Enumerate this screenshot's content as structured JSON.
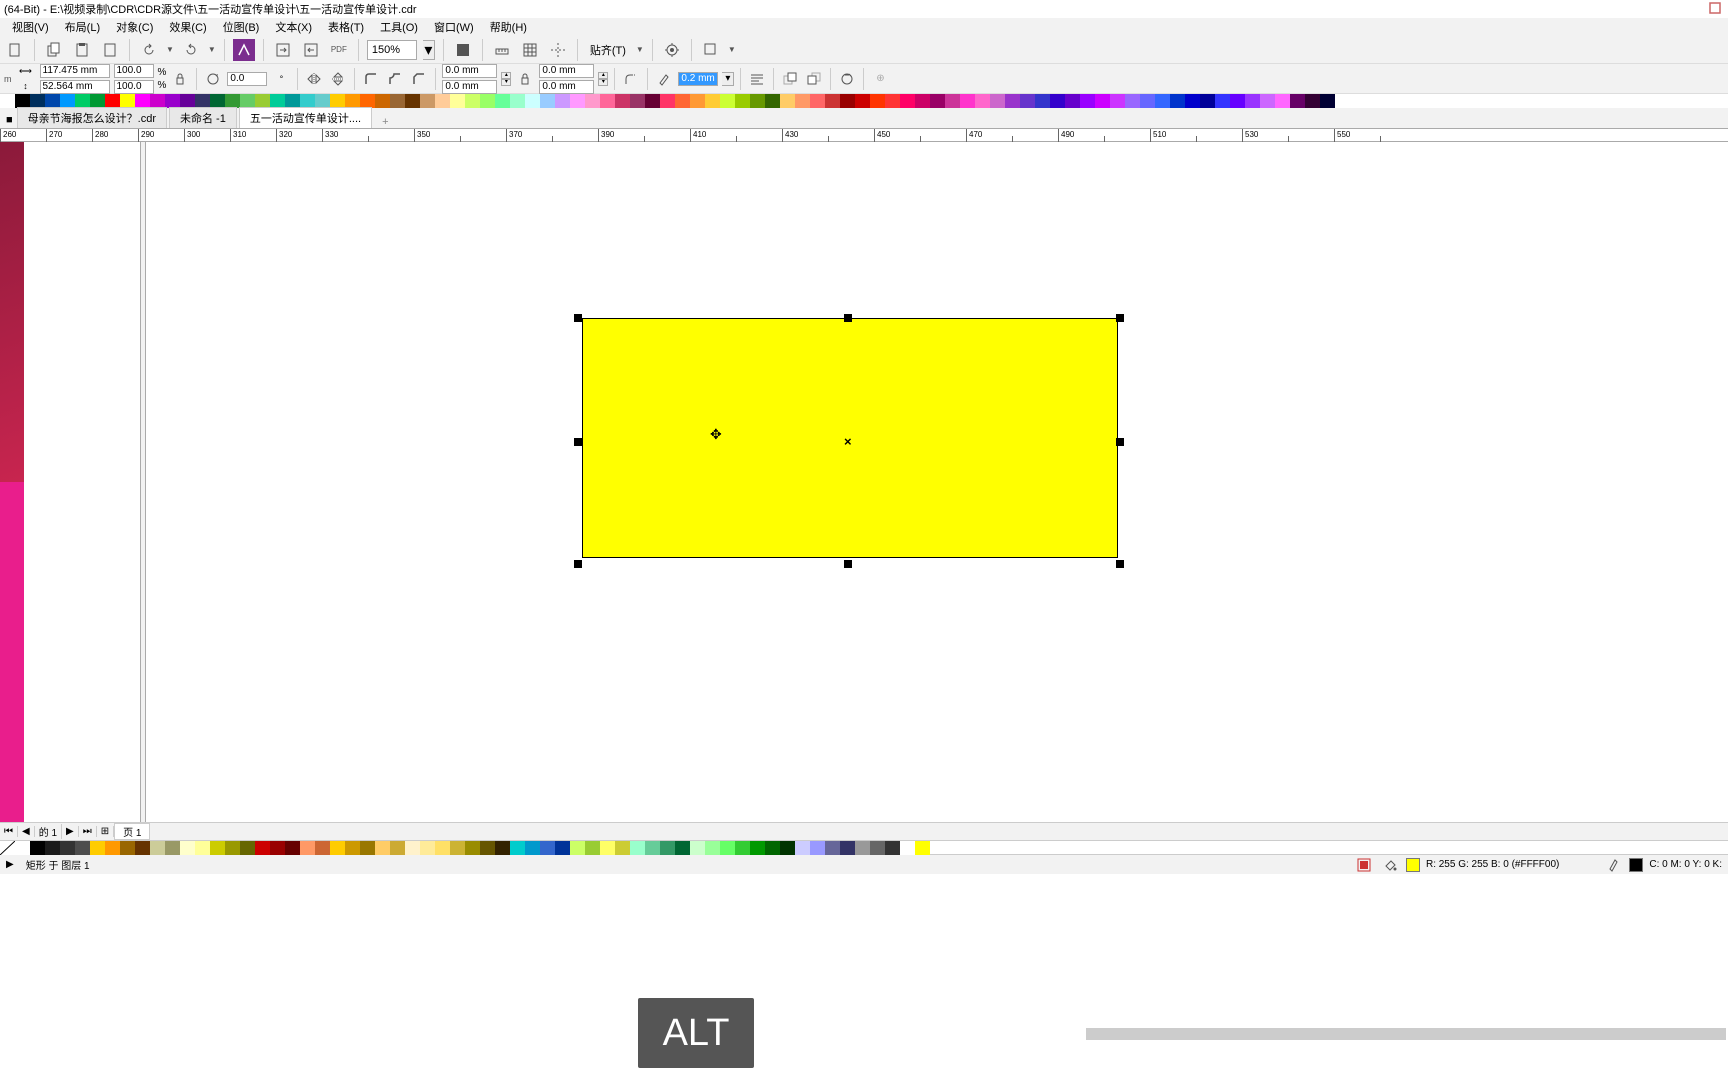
{
  "title": "(64-Bit) - E:\\视频录制\\CDR\\CDR源文件\\五一活动宣传单设计\\五一活动宣传单设计.cdr",
  "menu": [
    "视图(V)",
    "布局(L)",
    "对象(C)",
    "效果(C)",
    "位图(B)",
    "文本(X)",
    "表格(T)",
    "工具(O)",
    "窗口(W)",
    "帮助(H)"
  ],
  "zoom": "150%",
  "snap_label": "贴齐(T)",
  "size": {
    "w": "117.475 mm",
    "h": "52.564 mm"
  },
  "scale": {
    "x": "100.0",
    "y": "100.0"
  },
  "pct": "%",
  "rotation": "0.0",
  "corner": {
    "tl": "0.0 mm",
    "bl": "0.0 mm",
    "tr": "0.0 mm",
    "br": "0.0 mm"
  },
  "outline_w": "0.2 mm",
  "tabs": [
    "母亲节海报怎么设计？.cdr",
    "未命名 -1",
    "五一活动宣传单设计...."
  ],
  "ruler_ticks": [
    260,
    280,
    300,
    320,
    350,
    370,
    390,
    410,
    430,
    450,
    470,
    490,
    510,
    530,
    550
  ],
  "page_info": "的 1",
  "page_label": "页 1",
  "status_left": "矩形 于 图层 1",
  "status_fill": "R: 255 G: 255 B: 0 (#FFFF00)",
  "status_stroke": "C: 0 M: 0 Y: 0 K:",
  "key_overlay": "ALT",
  "palette_top": [
    "#ffffff",
    "#000000",
    "#002f5d",
    "#0047ab",
    "#0099ff",
    "#00cc66",
    "#009933",
    "#ff0000",
    "#ffff00",
    "#ff00ff",
    "#cc00cc",
    "#9900cc",
    "#660099",
    "#333366",
    "#006633",
    "#339933",
    "#66cc66",
    "#99cc33",
    "#00cc99",
    "#009999",
    "#33cccc",
    "#66cccc",
    "#ffcc00",
    "#ff9900",
    "#ff6600",
    "#cc6600",
    "#996633",
    "#663300",
    "#cc9966",
    "#ffcc99",
    "#ffff99",
    "#ccff66",
    "#99ff66",
    "#66ff99",
    "#99ffcc",
    "#ccffff",
    "#99ccff",
    "#cc99ff",
    "#ff99ff",
    "#ff99cc",
    "#ff6699",
    "#cc3366",
    "#993366",
    "#660033",
    "#ff3366",
    "#ff6633",
    "#ff9933",
    "#ffcc33",
    "#ccff33",
    "#99cc00",
    "#669900",
    "#336600",
    "#ffcc66",
    "#ff9966",
    "#ff6666",
    "#cc3333",
    "#990000",
    "#cc0000",
    "#ff3300",
    "#ff3333",
    "#ff0066",
    "#cc0066",
    "#990066",
    "#cc3399",
    "#ff33cc",
    "#ff66cc",
    "#cc66cc",
    "#9933cc",
    "#6633cc",
    "#3333cc",
    "#3300cc",
    "#6600cc",
    "#9900ff",
    "#cc00ff",
    "#cc33ff",
    "#9966ff",
    "#6666ff",
    "#3366ff",
    "#0033cc",
    "#0000cc",
    "#000099",
    "#3333ff",
    "#6600ff",
    "#9933ff",
    "#cc66ff",
    "#ff66ff",
    "#660066",
    "#330033",
    "#000033"
  ],
  "palette_bot": [
    "#ffffff",
    "#000000",
    "#1a1a1a",
    "#333333",
    "#4d4d4d",
    "#ffcc00",
    "#ff9900",
    "#996600",
    "#663300",
    "#cccc99",
    "#999966",
    "#ffffcc",
    "#ffff99",
    "#cccc00",
    "#999900",
    "#666600",
    "#cc0000",
    "#990000",
    "#660000",
    "#ff9966",
    "#cc6633",
    "#ffcc00",
    "#cc9900",
    "#997700",
    "#ffcc66",
    "#ccaa33",
    "#fff2cc",
    "#ffeb99",
    "#ffe066",
    "#ccb333",
    "#998c00",
    "#665500",
    "#332200",
    "#00cccc",
    "#0099cc",
    "#3366cc",
    "#003399",
    "#ccff66",
    "#99cc33",
    "#ffff66",
    "#cccc33",
    "#99ffcc",
    "#66cc99",
    "#339966",
    "#006633",
    "#ccffcc",
    "#99ff99",
    "#66ff66",
    "#33cc33",
    "#009900",
    "#006600",
    "#003300",
    "#ccccff",
    "#9999ff",
    "#666699",
    "#333366",
    "#999999",
    "#666666",
    "#333333",
    "#ffffff",
    "#ffff00"
  ]
}
